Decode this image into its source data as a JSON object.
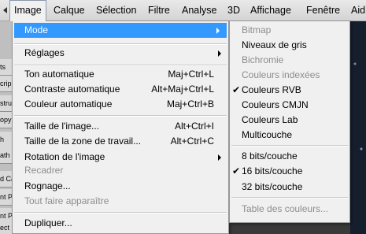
{
  "menubar": {
    "items": [
      {
        "label": "Image",
        "active": true
      },
      {
        "label": "Calque"
      },
      {
        "label": "Sélection"
      },
      {
        "label": "Filtre"
      },
      {
        "label": "Analyse"
      },
      {
        "label": "3D"
      },
      {
        "label": "Affichage"
      },
      {
        "label": "Fenêtre"
      },
      {
        "label": "Aid"
      }
    ]
  },
  "left_panel": {
    "items": [
      "ts",
      "crip",
      "stru",
      "opy",
      "h",
      "ath",
      "d Ca",
      "nt P",
      "nt P",
      "ect"
    ]
  },
  "image_menu": {
    "mode": "Mode",
    "reglages": "Réglages",
    "ton_auto": "Ton automatique",
    "ton_auto_sc": "Maj+Ctrl+L",
    "contraste_auto": "Contraste automatique",
    "contraste_auto_sc": "Alt+Maj+Ctrl+L",
    "couleur_auto": "Couleur automatique",
    "couleur_auto_sc": "Maj+Ctrl+B",
    "taille_image": "Taille de l'image...",
    "taille_image_sc": "Alt+Ctrl+I",
    "taille_zone": "Taille de la zone de travail...",
    "taille_zone_sc": "Alt+Ctrl+C",
    "rotation": "Rotation de l'image",
    "recadrer": "Recadrer",
    "rognage": "Rognage...",
    "tout_faire": "Tout faire apparaître",
    "dupliquer": "Dupliquer..."
  },
  "mode_submenu": {
    "bitmap": "Bitmap",
    "niveaux_gris": "Niveaux de gris",
    "bichromie": "Bichromie",
    "couleurs_indexees": "Couleurs indexées",
    "couleurs_rvb": "Couleurs RVB",
    "couleurs_cmjn": "Couleurs CMJN",
    "couleurs_lab": "Couleurs Lab",
    "multicouche": "Multicouche",
    "bits8": "8 bits/couche",
    "bits16": "16 bits/couche",
    "bits32": "32 bits/couche",
    "table_couleurs": "Table des couleurs...",
    "check_mark": "✔"
  },
  "colors": {
    "highlight": "#3399ff",
    "disabled_text": "#8d8d8d"
  }
}
